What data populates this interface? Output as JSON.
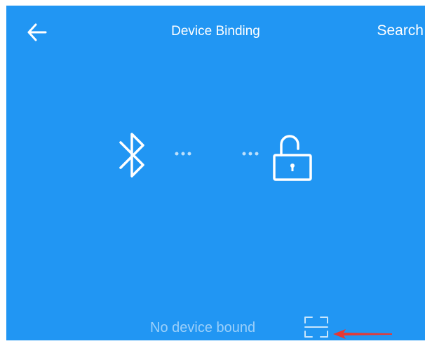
{
  "header": {
    "title": "Device Binding",
    "search_label": "Search",
    "back_icon": "arrow-left-icon"
  },
  "main": {
    "bluetooth_icon": "bluetooth-icon",
    "lock_icon": "unlocked-padlock-icon",
    "status_text": "No device bound",
    "scan_icon": "scan-frame-icon"
  },
  "colors": {
    "background": "#2196f3",
    "foreground": "#ffffff",
    "annotation_arrow": "#e53935"
  }
}
